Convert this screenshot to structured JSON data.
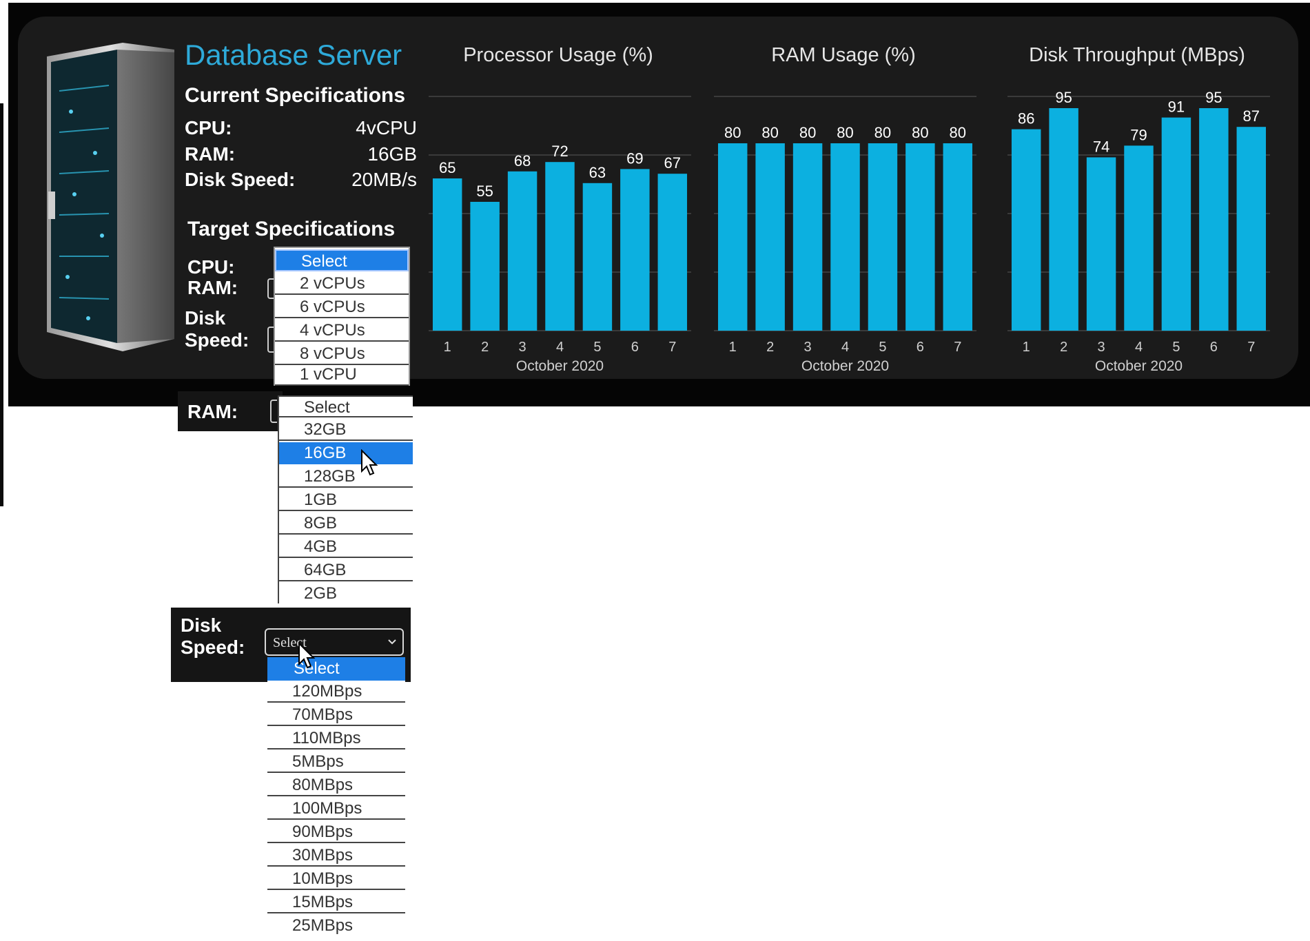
{
  "server": {
    "title": "Database Server",
    "current_heading": "Current Specifications",
    "current": [
      {
        "label": "CPU:",
        "value": "4vCPU"
      },
      {
        "label": "RAM:",
        "value": "16GB"
      },
      {
        "label": "Disk Speed:",
        "value": "20MB/s"
      }
    ],
    "target_heading": "Target Specifications",
    "target_labels": {
      "cpu": "CPU:",
      "ram": "RAM:",
      "disk_line1": "Disk",
      "disk_line2": "Speed:"
    }
  },
  "dropdowns": {
    "cpu": {
      "options": [
        "Select",
        "2 vCPUs",
        "6 vCPUs",
        "4 vCPUs",
        "8 vCPUs",
        "1 vCPU"
      ],
      "highlighted": "Select"
    },
    "ram": {
      "label": "RAM:",
      "options": [
        "Select",
        "32GB",
        "16GB",
        "128GB",
        "1GB",
        "8GB",
        "4GB",
        "64GB",
        "2GB"
      ],
      "highlighted": "16GB"
    },
    "disk": {
      "label_line1": "Disk",
      "label_line2": "Speed:",
      "selected_value": "Select",
      "options": [
        "Select",
        "120MBps",
        "70MBps",
        "110MBps",
        "5MBps",
        "80MBps",
        "100MBps",
        "90MBps",
        "30MBps",
        "10MBps",
        "15MBps",
        "25MBps"
      ],
      "highlighted": "Select"
    }
  },
  "colors": {
    "bar": "#0cb0e0",
    "title_accent": "#2eaad9",
    "highlight": "#1e7fe6"
  },
  "chart_data": [
    {
      "type": "bar",
      "title": "Processor Usage (%)",
      "xlabel": "October 2020",
      "categories": [
        "1",
        "2",
        "3",
        "4",
        "5",
        "6",
        "7"
      ],
      "values": [
        65,
        55,
        68,
        72,
        63,
        69,
        67
      ],
      "ylim": [
        0,
        100
      ]
    },
    {
      "type": "bar",
      "title": "RAM Usage (%)",
      "xlabel": "October 2020",
      "categories": [
        "1",
        "2",
        "3",
        "4",
        "5",
        "6",
        "7"
      ],
      "values": [
        80,
        80,
        80,
        80,
        80,
        80,
        80
      ],
      "ylim": [
        0,
        100
      ]
    },
    {
      "type": "bar",
      "title": "Disk Throughput (MBps)",
      "xlabel": "October 2020",
      "categories": [
        "1",
        "2",
        "3",
        "4",
        "5",
        "6",
        "7"
      ],
      "values": [
        86,
        95,
        74,
        79,
        91,
        95,
        87
      ],
      "ylim": [
        0,
        100
      ]
    }
  ]
}
